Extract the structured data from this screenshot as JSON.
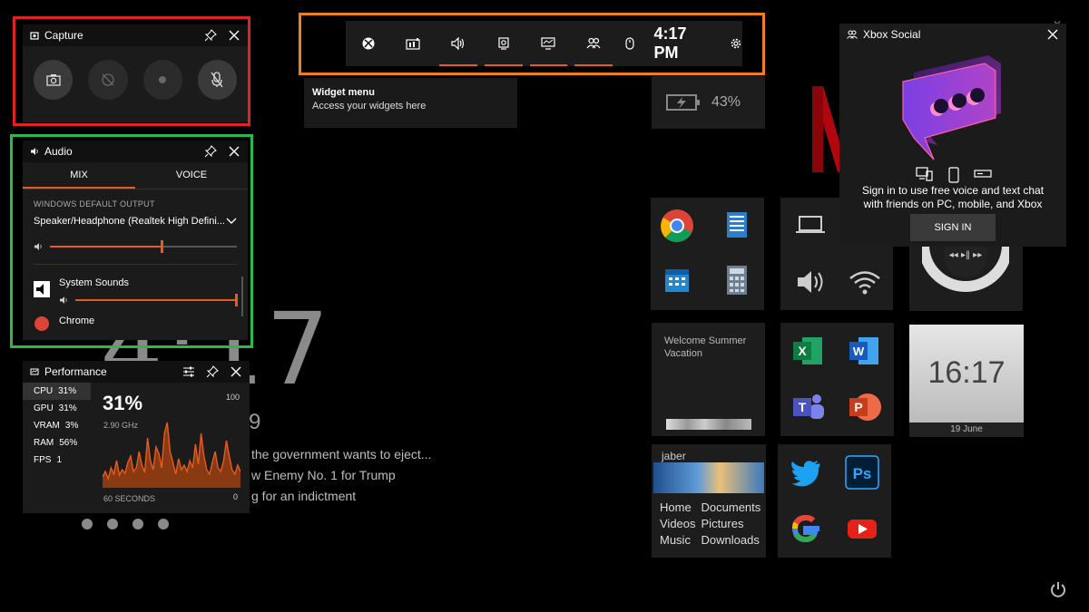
{
  "colors": {
    "accent": "#e65c1e",
    "highlight_capture": "#e02424",
    "highlight_audio": "#2fb84a",
    "highlight_toolbar": "#f07d24"
  },
  "background": {
    "clock": "4:17",
    "date_suffix": "9",
    "news": [
      "the government wants to eject...",
      "w Enemy No. 1 for Trump",
      "g for an indictment"
    ],
    "battery_percent": "43%",
    "summer_tile_text": "Welcome Summer Vacation",
    "clock_tile": {
      "time": "16:17",
      "date": "19 June"
    },
    "explorer_tile": {
      "user": "jaber",
      "links": [
        "Home",
        "Documents",
        "Videos",
        "Pictures",
        "Music",
        "Downloads"
      ]
    }
  },
  "capture": {
    "title": "Capture",
    "buttons": [
      "screenshot-icon",
      "record-last-icon",
      "record-icon",
      "mic-off-icon"
    ]
  },
  "audio": {
    "title": "Audio",
    "tabs": [
      "MIX",
      "VOICE"
    ],
    "active_tab": "MIX",
    "output_label": "WINDOWS DEFAULT OUTPUT",
    "device": "Speaker/Headphone (Realtek High Defini...",
    "master_volume": 0.6,
    "apps": [
      {
        "name": "System Sounds",
        "volume": 1.0
      },
      {
        "name": "Chrome"
      }
    ]
  },
  "performance": {
    "title": "Performance",
    "metrics": [
      {
        "label": "CPU",
        "value": "31%"
      },
      {
        "label": "GPU",
        "value": "31%"
      },
      {
        "label": "VRAM",
        "value": "3%"
      },
      {
        "label": "RAM",
        "value": "56%"
      },
      {
        "label": "FPS",
        "value": "1"
      }
    ],
    "big_value": "31%",
    "frequency": "2.90 GHz",
    "scale_max": "100",
    "scale_min": "0",
    "window_label": "60 SECONDS",
    "cpu_history": [
      12,
      18,
      10,
      22,
      15,
      30,
      14,
      20,
      16,
      28,
      35,
      18,
      22,
      40,
      25,
      17,
      55,
      30,
      20,
      45,
      38,
      22,
      60,
      72,
      40,
      28,
      15,
      32,
      20,
      25,
      18,
      30,
      22,
      48,
      26,
      60,
      35,
      20,
      15,
      28,
      40,
      22,
      18,
      30,
      52,
      35,
      20,
      15,
      25,
      18
    ]
  },
  "toolbar": {
    "time": "4:17 PM",
    "buttons": [
      {
        "icon": "xbox-icon",
        "active": false
      },
      {
        "icon": "widget-menu-icon",
        "active": false
      },
      {
        "icon": "audio-icon",
        "active": true
      },
      {
        "icon": "capture-icon",
        "active": true
      },
      {
        "icon": "performance-icon",
        "active": true
      },
      {
        "icon": "social-icon",
        "active": true
      }
    ]
  },
  "widget_tooltip": {
    "title": "Widget menu",
    "subtitle": "Access your widgets here"
  },
  "xbox_social": {
    "title": "Xbox Social",
    "message_line1": "Sign in to use free voice and text chat",
    "message_line2": "with friends on PC, mobile, and Xbox",
    "sign_in": "SIGN IN"
  }
}
